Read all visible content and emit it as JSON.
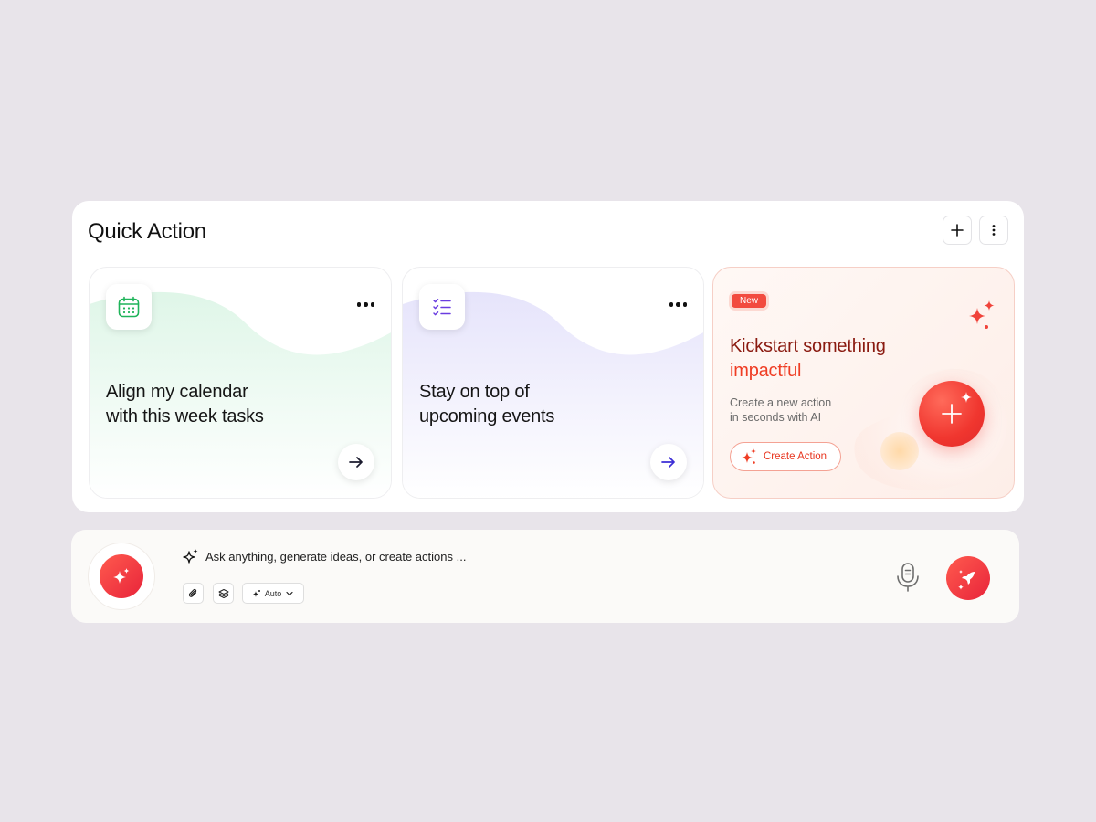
{
  "panel": {
    "title": "Quick Action",
    "add_icon": "plus-icon",
    "more_icon": "vertical-dots-icon"
  },
  "cards": [
    {
      "title": "Align my calendar with this week tasks",
      "line1": "Align my calendar",
      "line2": "with this week tasks",
      "icon": "calendar-icon",
      "accent": "#1fb45a",
      "wave_color": "#e6f8ee"
    },
    {
      "title": "Stay on top of upcoming events",
      "line1": "Stay on top of",
      "line2": "upcoming events",
      "icon": "checklist-icon",
      "accent": "#6a3de0",
      "wave_color": "#eceafd"
    }
  ],
  "promo": {
    "badge": "New",
    "title_line1": "Kickstart something",
    "title_line2": "impactful",
    "subtitle_line1": "Create a new action",
    "subtitle_line2": "in seconds with AI",
    "button_label": "Create Action",
    "accent": "#ef3d24"
  },
  "chat": {
    "prompt": "Ask anything, generate ideas, or create actions ...",
    "mode_label": "Auto",
    "tools": [
      "paperclip-icon",
      "layers-icon",
      "sparkle-icon"
    ],
    "accent": "#f03a3a"
  }
}
